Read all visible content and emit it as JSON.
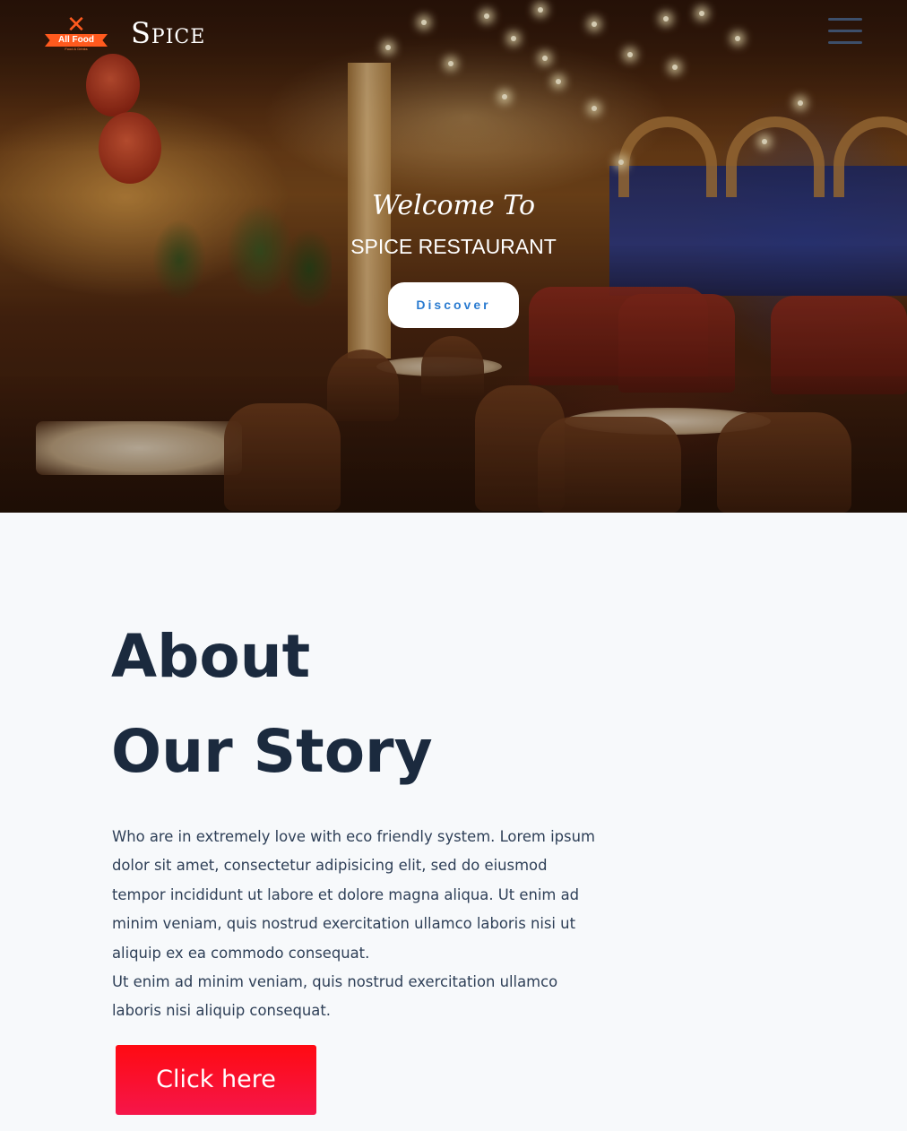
{
  "header": {
    "logo_text": "All Food",
    "logo_tagline": "Food & Drinks",
    "brand": "Spice"
  },
  "hero": {
    "welcome": "Welcome To",
    "title": "SPICE RESTAURANT",
    "cta_label": "Discover"
  },
  "about": {
    "title_line1": "About",
    "title_line2": "Our Story",
    "paragraph1": "Who are in extremely love with eco friendly system. Lorem ipsum dolor sit amet, consectetur adipisicing elit, sed do eiusmod tempor incididunt ut labore et dolore magna aliqua. Ut enim ad minim veniam, quis nostrud exercitation ullamco laboris nisi ut aliquip ex ea commodo consequat.",
    "paragraph2": "Ut enim ad minim veniam, quis nostrud exercitation ullamco laboris nisi aliquip consequat.",
    "button_label": "Click here"
  },
  "colors": {
    "brand_orange": "#ff5a1e",
    "heading": "#1b2a3e",
    "body_text": "#2e3f57",
    "button_red": "#ff0a12",
    "discover_text": "#2a7bd0",
    "page_bg": "#f7f9fb"
  },
  "icons": {
    "menu": "hamburger-icon",
    "logo": "crossed-utensils-icon"
  }
}
